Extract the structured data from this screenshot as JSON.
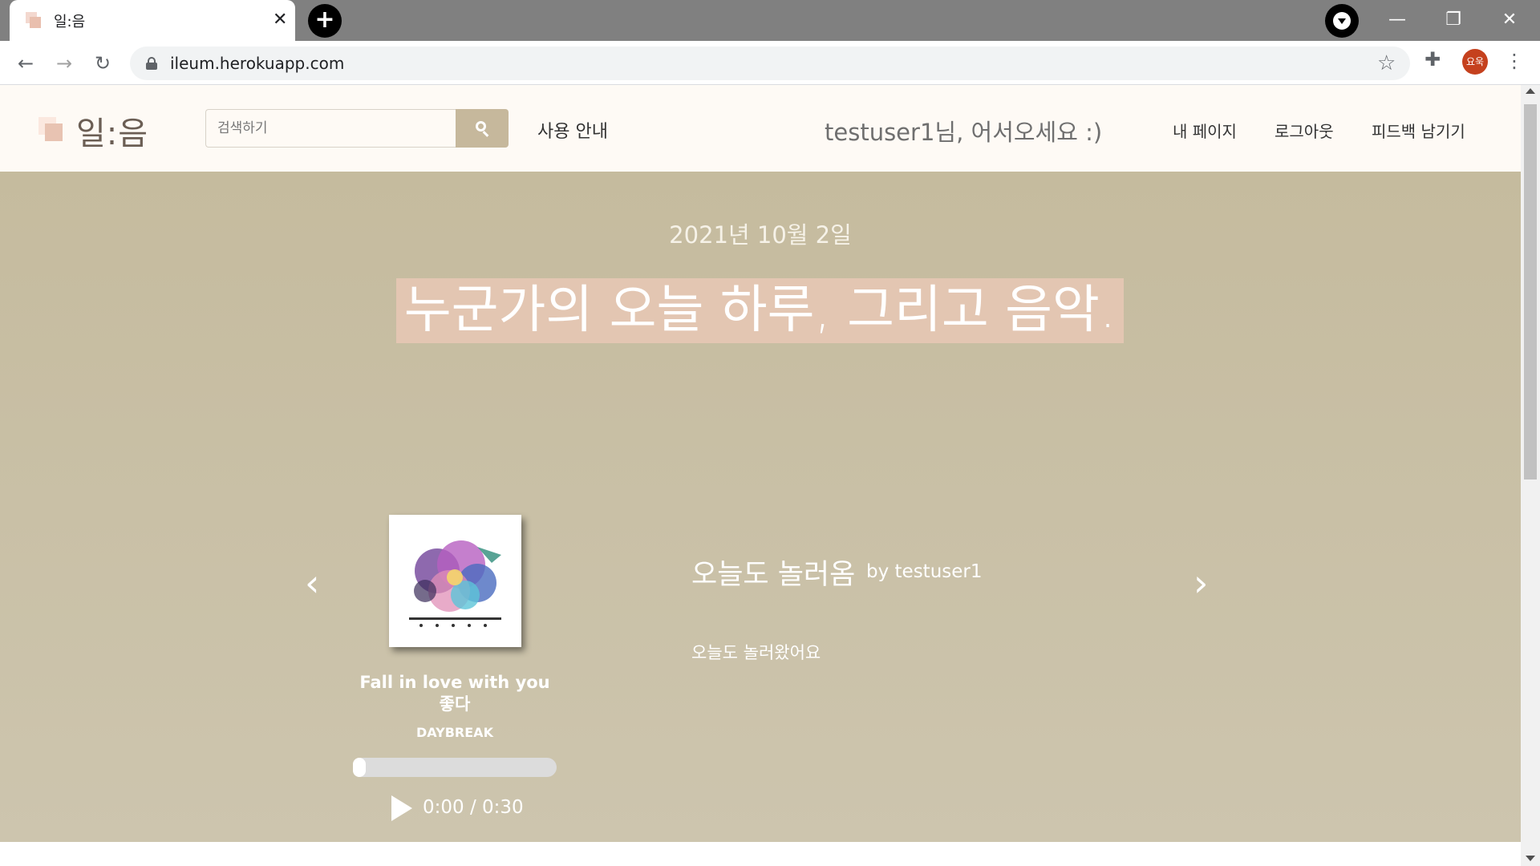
{
  "browser": {
    "tab": {
      "title": "일:음",
      "close_icon": "close-icon"
    },
    "new_tab_icon": "+",
    "url": "ileum.herokuapp.com",
    "profile_initials": "요욱",
    "window_controls": {
      "minimize": "—",
      "restore": "❐",
      "close": "✕"
    },
    "nav": {
      "back": "←",
      "forward": "→",
      "reload": "↻",
      "star": "☆",
      "extensions": "✚",
      "menu": "⋮"
    }
  },
  "site": {
    "logo_text": "일:음",
    "search": {
      "placeholder": "검색하기",
      "value": ""
    },
    "usage_link": "사용 안내",
    "welcome": "testuser1님, 어서오세요 :)",
    "nav_links": [
      "내 페이지",
      "로그아웃",
      "피드백 남기기"
    ]
  },
  "hero": {
    "date": "2021년 10월 2일",
    "tagline": "누군가의 오늘 하루, 그리고 음악.",
    "prev_arrow": "‹",
    "next_arrow": "›"
  },
  "player": {
    "song_title": "Fall in love with you 좋다",
    "artist": "DAYBREAK",
    "progress": 0,
    "time": "0:00 / 0:30"
  },
  "post": {
    "title": "오늘도 놀러옴",
    "author": "by testuser1",
    "body": "오늘도 놀러왔어요"
  },
  "colors": {
    "hero_bg": "#c5bb9e",
    "header_bg": "#fefaf5",
    "tagline_highlight": "#e3c6b2",
    "search_button": "#c6b89c",
    "profile_avatar": "#c5411e"
  }
}
